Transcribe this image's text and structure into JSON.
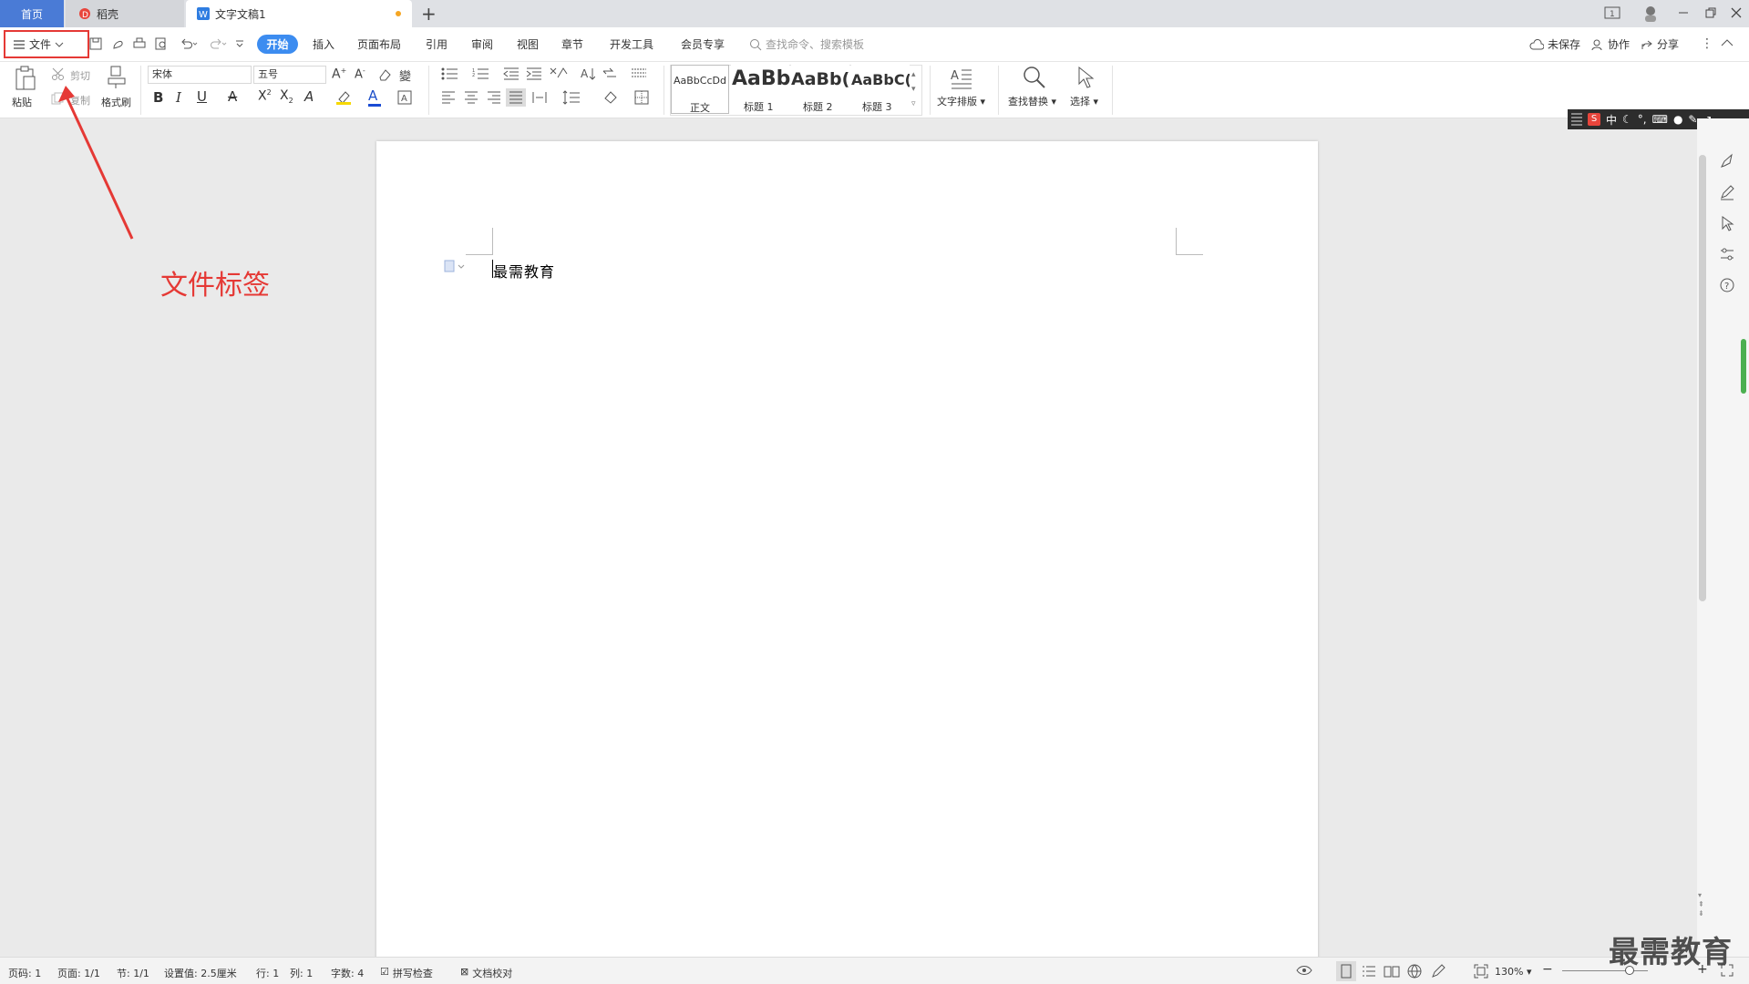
{
  "tabs": {
    "home": "首页",
    "docer": "稻壳",
    "doc": "文字文稿1",
    "add": "+"
  },
  "menu": {
    "file": "文件",
    "items": [
      "开始",
      "插入",
      "页面布局",
      "引用",
      "审阅",
      "视图",
      "章节",
      "开发工具",
      "会员专享"
    ],
    "search_placeholder": "查找命令、搜索模板",
    "unsaved": "未保存",
    "collab": "协作",
    "share": "分享"
  },
  "ribbon": {
    "paste": "粘贴",
    "cut": "剪切",
    "copy": "复制",
    "format_painter": "格式刷",
    "font": "宋体",
    "size": "五号",
    "styles": [
      {
        "preview": "AaBbCcDd",
        "name": "正文"
      },
      {
        "preview": "AaBb",
        "name": "标题 1"
      },
      {
        "preview": "AaBb(",
        "name": "标题 2"
      },
      {
        "preview": "AaBbC(",
        "name": "标题 3"
      }
    ],
    "text_layout": "文字排版",
    "find_replace": "查找替换",
    "select": "选择"
  },
  "ime": {
    "label": "中"
  },
  "document": {
    "content": "最需教育"
  },
  "annotation": {
    "label": "文件标签"
  },
  "status": {
    "page_num": "页码: 1",
    "pages": "页面: 1/1",
    "section": "节: 1/1",
    "setting": "设置值: 2.5厘米",
    "row": "行: 1",
    "col": "列: 1",
    "words": "字数: 4",
    "spell": "拼写检查",
    "proof": "文档校对",
    "zoom": "130%"
  },
  "watermark": "最需教育",
  "colors": {
    "accent": "#3c8cf0",
    "annotation": "#e53935",
    "home_tab": "#4a7bd6"
  }
}
